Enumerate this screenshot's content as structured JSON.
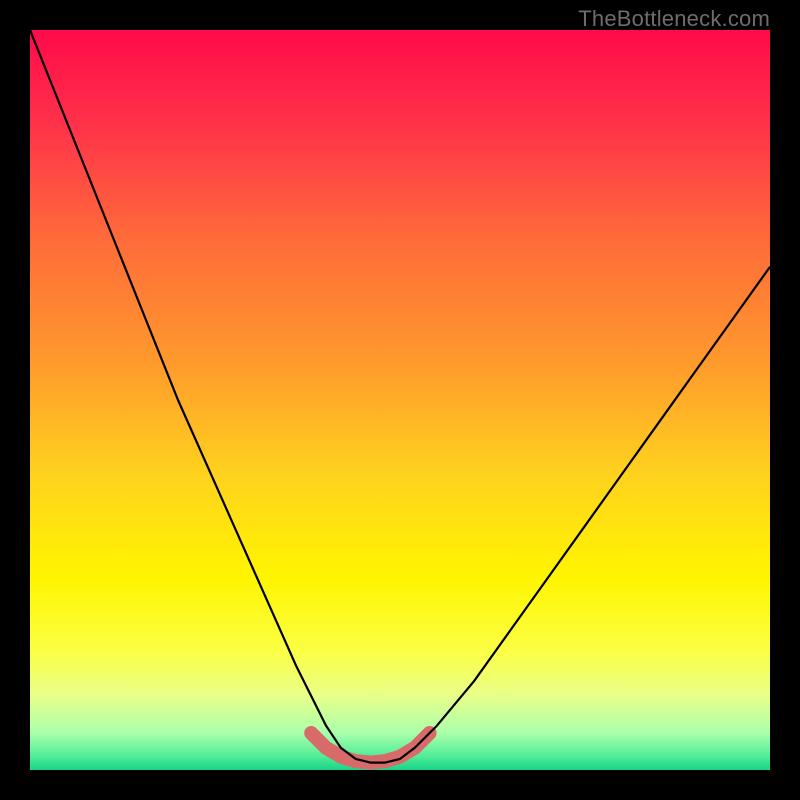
{
  "watermark": "TheBottleneck.com",
  "chart_data": {
    "type": "line",
    "title": "",
    "xlabel": "",
    "ylabel": "",
    "xlim": [
      0,
      1
    ],
    "ylim": [
      0,
      100
    ],
    "series": [
      {
        "name": "bottleneck-curve",
        "x": [
          0.0,
          0.04,
          0.08,
          0.12,
          0.16,
          0.2,
          0.24,
          0.28,
          0.32,
          0.36,
          0.38,
          0.4,
          0.42,
          0.44,
          0.46,
          0.48,
          0.5,
          0.52,
          0.55,
          0.6,
          0.65,
          0.7,
          0.75,
          0.8,
          0.85,
          0.9,
          0.95,
          1.0
        ],
        "values": [
          100,
          90,
          80,
          70,
          60,
          50,
          41,
          32,
          23,
          14,
          10,
          6,
          3,
          1.5,
          1,
          1,
          1.5,
          3,
          6,
          12,
          19,
          26,
          33,
          40,
          47,
          54,
          61,
          68
        ]
      },
      {
        "name": "optimal-band",
        "x": [
          0.38,
          0.4,
          0.42,
          0.44,
          0.46,
          0.48,
          0.5,
          0.52,
          0.54
        ],
        "values": [
          5,
          3,
          1.8,
          1.2,
          1.0,
          1.2,
          1.8,
          3,
          5
        ]
      }
    ],
    "gradient_stops": [
      {
        "offset": 0.0,
        "color": "#ff0a4a"
      },
      {
        "offset": 0.12,
        "color": "#ff2f4a"
      },
      {
        "offset": 0.28,
        "color": "#ff6a3a"
      },
      {
        "offset": 0.45,
        "color": "#ff9a2c"
      },
      {
        "offset": 0.6,
        "color": "#ffd21e"
      },
      {
        "offset": 0.74,
        "color": "#fff500"
      },
      {
        "offset": 0.84,
        "color": "#fbff45"
      },
      {
        "offset": 0.9,
        "color": "#e8ff8a"
      },
      {
        "offset": 0.95,
        "color": "#aaffaa"
      },
      {
        "offset": 0.98,
        "color": "#55ee99"
      },
      {
        "offset": 1.0,
        "color": "#18d488"
      }
    ],
    "optimal_band_color": "#d96a6a",
    "curve_color": "#000000"
  }
}
